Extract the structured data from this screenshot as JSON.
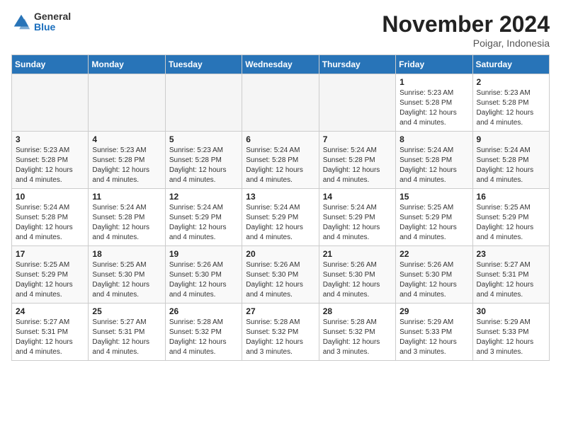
{
  "header": {
    "logo_general": "General",
    "logo_blue": "Blue",
    "month_title": "November 2024",
    "subtitle": "Poigar, Indonesia"
  },
  "days_of_week": [
    "Sunday",
    "Monday",
    "Tuesday",
    "Wednesday",
    "Thursday",
    "Friday",
    "Saturday"
  ],
  "weeks": [
    [
      {
        "day": "",
        "empty": true
      },
      {
        "day": "",
        "empty": true
      },
      {
        "day": "",
        "empty": true
      },
      {
        "day": "",
        "empty": true
      },
      {
        "day": "",
        "empty": true
      },
      {
        "day": "1",
        "sunrise": "Sunrise: 5:23 AM",
        "sunset": "Sunset: 5:28 PM",
        "daylight": "Daylight: 12 hours and 4 minutes."
      },
      {
        "day": "2",
        "sunrise": "Sunrise: 5:23 AM",
        "sunset": "Sunset: 5:28 PM",
        "daylight": "Daylight: 12 hours and 4 minutes."
      }
    ],
    [
      {
        "day": "3",
        "sunrise": "Sunrise: 5:23 AM",
        "sunset": "Sunset: 5:28 PM",
        "daylight": "Daylight: 12 hours and 4 minutes."
      },
      {
        "day": "4",
        "sunrise": "Sunrise: 5:23 AM",
        "sunset": "Sunset: 5:28 PM",
        "daylight": "Daylight: 12 hours and 4 minutes."
      },
      {
        "day": "5",
        "sunrise": "Sunrise: 5:23 AM",
        "sunset": "Sunset: 5:28 PM",
        "daylight": "Daylight: 12 hours and 4 minutes."
      },
      {
        "day": "6",
        "sunrise": "Sunrise: 5:24 AM",
        "sunset": "Sunset: 5:28 PM",
        "daylight": "Daylight: 12 hours and 4 minutes."
      },
      {
        "day": "7",
        "sunrise": "Sunrise: 5:24 AM",
        "sunset": "Sunset: 5:28 PM",
        "daylight": "Daylight: 12 hours and 4 minutes."
      },
      {
        "day": "8",
        "sunrise": "Sunrise: 5:24 AM",
        "sunset": "Sunset: 5:28 PM",
        "daylight": "Daylight: 12 hours and 4 minutes."
      },
      {
        "day": "9",
        "sunrise": "Sunrise: 5:24 AM",
        "sunset": "Sunset: 5:28 PM",
        "daylight": "Daylight: 12 hours and 4 minutes."
      }
    ],
    [
      {
        "day": "10",
        "sunrise": "Sunrise: 5:24 AM",
        "sunset": "Sunset: 5:28 PM",
        "daylight": "Daylight: 12 hours and 4 minutes."
      },
      {
        "day": "11",
        "sunrise": "Sunrise: 5:24 AM",
        "sunset": "Sunset: 5:28 PM",
        "daylight": "Daylight: 12 hours and 4 minutes."
      },
      {
        "day": "12",
        "sunrise": "Sunrise: 5:24 AM",
        "sunset": "Sunset: 5:29 PM",
        "daylight": "Daylight: 12 hours and 4 minutes."
      },
      {
        "day": "13",
        "sunrise": "Sunrise: 5:24 AM",
        "sunset": "Sunset: 5:29 PM",
        "daylight": "Daylight: 12 hours and 4 minutes."
      },
      {
        "day": "14",
        "sunrise": "Sunrise: 5:24 AM",
        "sunset": "Sunset: 5:29 PM",
        "daylight": "Daylight: 12 hours and 4 minutes."
      },
      {
        "day": "15",
        "sunrise": "Sunrise: 5:25 AM",
        "sunset": "Sunset: 5:29 PM",
        "daylight": "Daylight: 12 hours and 4 minutes."
      },
      {
        "day": "16",
        "sunrise": "Sunrise: 5:25 AM",
        "sunset": "Sunset: 5:29 PM",
        "daylight": "Daylight: 12 hours and 4 minutes."
      }
    ],
    [
      {
        "day": "17",
        "sunrise": "Sunrise: 5:25 AM",
        "sunset": "Sunset: 5:29 PM",
        "daylight": "Daylight: 12 hours and 4 minutes."
      },
      {
        "day": "18",
        "sunrise": "Sunrise: 5:25 AM",
        "sunset": "Sunset: 5:30 PM",
        "daylight": "Daylight: 12 hours and 4 minutes."
      },
      {
        "day": "19",
        "sunrise": "Sunrise: 5:26 AM",
        "sunset": "Sunset: 5:30 PM",
        "daylight": "Daylight: 12 hours and 4 minutes."
      },
      {
        "day": "20",
        "sunrise": "Sunrise: 5:26 AM",
        "sunset": "Sunset: 5:30 PM",
        "daylight": "Daylight: 12 hours and 4 minutes."
      },
      {
        "day": "21",
        "sunrise": "Sunrise: 5:26 AM",
        "sunset": "Sunset: 5:30 PM",
        "daylight": "Daylight: 12 hours and 4 minutes."
      },
      {
        "day": "22",
        "sunrise": "Sunrise: 5:26 AM",
        "sunset": "Sunset: 5:30 PM",
        "daylight": "Daylight: 12 hours and 4 minutes."
      },
      {
        "day": "23",
        "sunrise": "Sunrise: 5:27 AM",
        "sunset": "Sunset: 5:31 PM",
        "daylight": "Daylight: 12 hours and 4 minutes."
      }
    ],
    [
      {
        "day": "24",
        "sunrise": "Sunrise: 5:27 AM",
        "sunset": "Sunset: 5:31 PM",
        "daylight": "Daylight: 12 hours and 4 minutes."
      },
      {
        "day": "25",
        "sunrise": "Sunrise: 5:27 AM",
        "sunset": "Sunset: 5:31 PM",
        "daylight": "Daylight: 12 hours and 4 minutes."
      },
      {
        "day": "26",
        "sunrise": "Sunrise: 5:28 AM",
        "sunset": "Sunset: 5:32 PM",
        "daylight": "Daylight: 12 hours and 4 minutes."
      },
      {
        "day": "27",
        "sunrise": "Sunrise: 5:28 AM",
        "sunset": "Sunset: 5:32 PM",
        "daylight": "Daylight: 12 hours and 3 minutes."
      },
      {
        "day": "28",
        "sunrise": "Sunrise: 5:28 AM",
        "sunset": "Sunset: 5:32 PM",
        "daylight": "Daylight: 12 hours and 3 minutes."
      },
      {
        "day": "29",
        "sunrise": "Sunrise: 5:29 AM",
        "sunset": "Sunset: 5:33 PM",
        "daylight": "Daylight: 12 hours and 3 minutes."
      },
      {
        "day": "30",
        "sunrise": "Sunrise: 5:29 AM",
        "sunset": "Sunset: 5:33 PM",
        "daylight": "Daylight: 12 hours and 3 minutes."
      }
    ]
  ]
}
